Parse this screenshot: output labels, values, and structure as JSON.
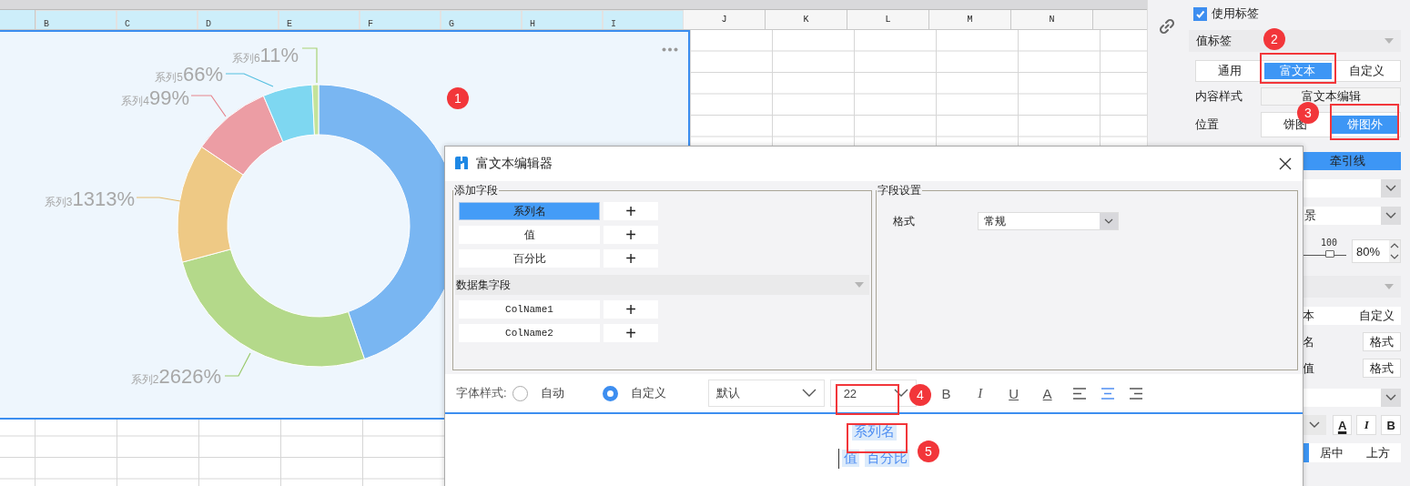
{
  "sheet": {
    "columns": [
      {
        "label": "B",
        "selected": true
      },
      {
        "label": "C",
        "selected": true
      },
      {
        "label": "D",
        "selected": true
      },
      {
        "label": "E",
        "selected": true
      },
      {
        "label": "F",
        "selected": true
      },
      {
        "label": "G",
        "selected": true
      },
      {
        "label": "H",
        "selected": true
      },
      {
        "label": "I",
        "selected": true
      },
      {
        "label": "J",
        "selected": false
      },
      {
        "label": "K",
        "selected": false
      },
      {
        "label": "L",
        "selected": false
      },
      {
        "label": "M",
        "selected": false
      },
      {
        "label": "N",
        "selected": false
      }
    ]
  },
  "chart": {
    "labels": [
      {
        "series": "系列6",
        "percent": "11%"
      },
      {
        "series": "系列5",
        "percent": "66%"
      },
      {
        "series": "系列4",
        "percent": "99%"
      },
      {
        "series": "系列3",
        "percent": "1313%"
      },
      {
        "series": "系列2",
        "percent": "2626%"
      }
    ]
  },
  "side_panel": {
    "use_label": {
      "label": "使用标签",
      "checked": true
    },
    "section": "值标签",
    "label_types": [
      {
        "label": "通用",
        "selected": false
      },
      {
        "label": "富文本",
        "selected": true
      },
      {
        "label": "自定义",
        "selected": false
      }
    ],
    "content_style": {
      "label": "内容样式",
      "button": "富文本编辑"
    },
    "position": {
      "label": "位置",
      "options": [
        {
          "label": "饼图",
          "selected": false
        },
        {
          "label": "饼图外",
          "selected": true
        }
      ]
    },
    "leader_line": "牵引线",
    "background_value": "景",
    "opacity": {
      "tick": "100",
      "level": 0.6,
      "value": "80%"
    },
    "label_tabs": [
      {
        "label": "本",
        "selected": false
      },
      {
        "label": "自定义",
        "selected": false
      }
    ],
    "format_rows": [
      {
        "label": "名",
        "button": "格式"
      },
      {
        "label": "值",
        "button": "格式"
      }
    ],
    "font_buttons": [
      "A",
      "I",
      "B"
    ],
    "align_options": [
      {
        "label": "居中",
        "selected": false
      },
      {
        "label": "上方",
        "selected": false
      }
    ]
  },
  "dialog": {
    "title": "富文本编辑器",
    "add_fields": {
      "legend": "添加字段",
      "fields": [
        {
          "label": "系列名",
          "selected": true,
          "add": "+"
        },
        {
          "label": "值",
          "selected": false,
          "add": "+"
        },
        {
          "label": "百分比",
          "selected": false,
          "add": "+"
        }
      ],
      "dataset_header": "数据集字段",
      "dataset_fields": [
        {
          "label": "ColName1",
          "add": "+"
        },
        {
          "label": "ColName2",
          "add": "+"
        }
      ]
    },
    "field_settings": {
      "legend": "字段设置",
      "format_label": "格式",
      "format_value": "常规"
    },
    "toolbar": {
      "font_style_label": "字体样式:",
      "modes": [
        {
          "label": "自动",
          "selected": false
        },
        {
          "label": "自定义",
          "selected": true
        }
      ],
      "font": "默认",
      "size": "22",
      "styles": [
        "B",
        "I",
        "U",
        "A"
      ],
      "aligns": [
        {
          "kind": "left",
          "selected": false
        },
        {
          "kind": "center",
          "selected": true
        },
        {
          "kind": "right",
          "selected": false
        }
      ]
    },
    "editor": {
      "lines": [
        {
          "tokens": [
            "系列名"
          ],
          "caret": false
        },
        {
          "tokens": [
            "值",
            "百分比"
          ],
          "caret": true
        }
      ]
    }
  },
  "annotations": [
    "1",
    "2",
    "3",
    "4",
    "5"
  ]
}
